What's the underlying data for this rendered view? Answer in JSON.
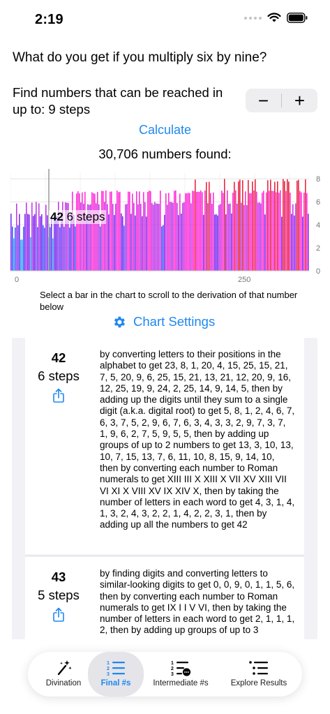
{
  "status": {
    "time": "2:19"
  },
  "question": "What do you get if you multiply six by nine?",
  "steps_control": {
    "label": "Find numbers that can be reached in up to: 9 steps",
    "minus": "−",
    "plus": "+"
  },
  "calculate_label": "Calculate",
  "numbers_found": "30,706 numbers found:",
  "chart_data": {
    "type": "bar",
    "x_ticks": [
      "0",
      "250"
    ],
    "y_ticks": [
      "0",
      "2",
      "4",
      "6",
      "8"
    ],
    "ylim": [
      0,
      8.5
    ],
    "selected": {
      "number": "42",
      "steps": "6 steps"
    },
    "series_colors": [
      "#2ecf6a",
      "#38a9f0",
      "#3f5cff",
      "#7a2ff0",
      "#c03be8",
      "#ff2fd8",
      "#e8283f"
    ],
    "step_values": [
      2,
      3,
      4,
      5,
      6,
      7,
      8
    ]
  },
  "chart_hint": "Select a bar in the chart to scroll to the derivation of that number below",
  "chart_settings_label": "Chart Settings",
  "results": [
    {
      "number": "42",
      "steps": "6 steps",
      "derivation": "by converting letters to their positions in the alphabet to get 23, 8, 1, 20, 4, 15, 25, 15, 21, 7, 5, 20, 9, 6, 25, 15, 21, 13, 21, 12, 20, 9, 16, 12, 25, 19, 9, 24, 2, 25, 14, 9, 14, 5, then by adding up the digits until they sum to a single digit (a.k.a. digital root) to get 5, 8, 1, 2, 4, 6, 7, 6, 3, 7, 5, 2, 9, 6, 7, 6, 3, 4, 3, 3, 2, 9, 7, 3, 7, 1, 9, 6, 2, 7, 5, 9, 5, 5, then by adding up groups of up to 2 numbers to get 13, 3, 10, 13, 10, 7, 15, 13, 7, 6, 11, 10, 8, 15, 9, 14, 10, then by converting each number to Roman numerals to get XIII III X XIII X VII XV XIII VII VI XI X VIII XV IX XIV X, then by taking the number of letters in each word to get 4, 3, 1, 4, 1, 3, 2, 4, 3, 2, 2, 1, 4, 2, 2, 3, 1, then by adding up all the numbers to get 42"
    },
    {
      "number": "43",
      "steps": "5 steps",
      "derivation": "by finding digits and converting letters to similar-looking digits to get 0, 0, 9, 0, 1, 1, 5, 6, then by converting each number to Roman numerals to get   IX  I I V VI, then by taking the number of letters in each word to get 2, 1, 1, 1, 2, then by adding up groups of up to 3"
    }
  ],
  "tabs": [
    {
      "label": "Divination",
      "icon": "magic-wand-icon"
    },
    {
      "label": "Final #s",
      "icon": "numbered-list-icon"
    },
    {
      "label": "Intermediate #s",
      "icon": "numbered-list-more-icon"
    },
    {
      "label": "Explore Results",
      "icon": "bulleted-list-icon"
    }
  ],
  "colors": {
    "accent": "#1e88f0",
    "panel": "#f2f2f6"
  }
}
